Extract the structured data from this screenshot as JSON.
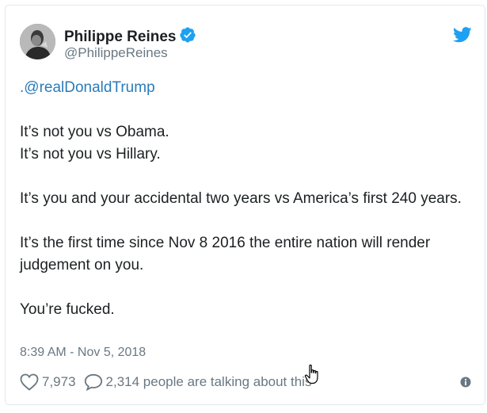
{
  "author": {
    "name": "Philippe Reines",
    "handle": "@PhilippeReines",
    "verified": true
  },
  "tweet": {
    "mention": ".@realDonaldTrump",
    "lines": [
      "It’s not you vs Obama.",
      "It’s not you vs Hillary.",
      "It’s you and your accidental two years vs America’s first 240 years.",
      "It’s the first time since Nov 8 2016 the entire nation will render judgement on you.",
      "You’re fucked."
    ]
  },
  "timestamp": "8:39 AM - Nov 5, 2018",
  "actions": {
    "likes": "7,973",
    "conversation": "2,314 people are talking about this"
  },
  "icons": {
    "brand": "twitter-bird-icon",
    "verified": "verified-badge-icon",
    "like": "heart-icon",
    "reply": "speech-bubble-icon",
    "info": "info-icon",
    "cursor": "hand-pointer-icon"
  },
  "colors": {
    "twitter_blue": "#1da1f2",
    "link": "#2b7bb9",
    "text": "#1c2022",
    "muted": "#697882",
    "border": "#e1e8ed"
  }
}
